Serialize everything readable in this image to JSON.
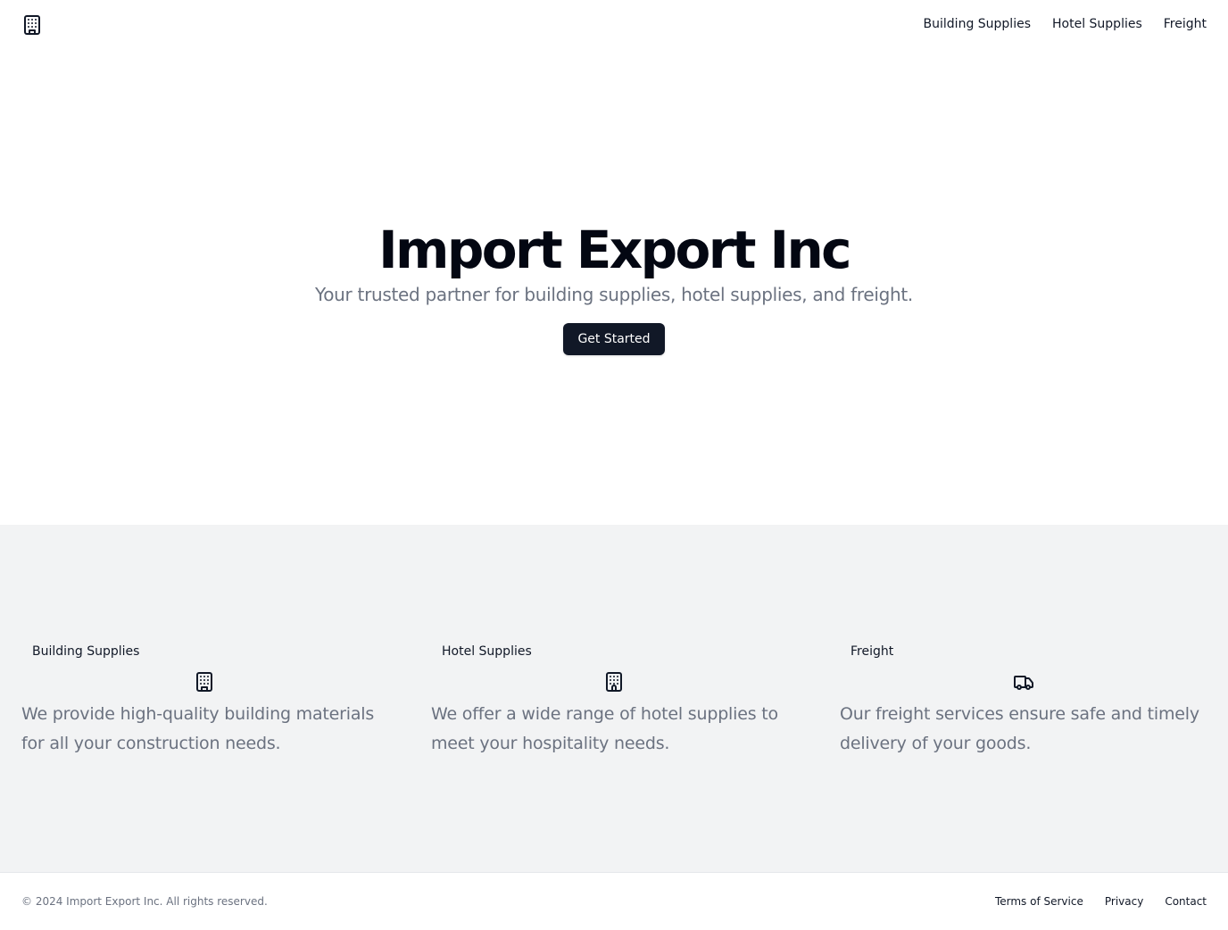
{
  "header": {
    "logo_icon": "building-icon",
    "nav": [
      {
        "label": "Building Supplies"
      },
      {
        "label": "Hotel Supplies"
      },
      {
        "label": "Freight"
      }
    ]
  },
  "hero": {
    "title": "Import Export Inc",
    "subtitle": "Your trusted partner for building supplies, hotel supplies, and freight.",
    "cta_label": "Get Started"
  },
  "services": [
    {
      "title": "Building Supplies",
      "icon": "building-icon",
      "description": "We provide high-quality building materials for all your construction needs."
    },
    {
      "title": "Hotel Supplies",
      "icon": "hotel-icon",
      "description": "We offer a wide range of hotel supplies to meet your hospitality needs."
    },
    {
      "title": "Freight",
      "icon": "truck-icon",
      "description": "Our freight services ensure safe and timely delivery of your goods."
    }
  ],
  "footer": {
    "copyright": "© 2024 Import Export Inc. All rights reserved.",
    "links": [
      {
        "label": "Terms of Service"
      },
      {
        "label": "Privacy"
      },
      {
        "label": "Contact"
      }
    ]
  },
  "colors": {
    "primary": "#111827",
    "muted_text": "#6b7280",
    "section_bg": "#f2f3f4",
    "page_bg": "#ffffff"
  }
}
